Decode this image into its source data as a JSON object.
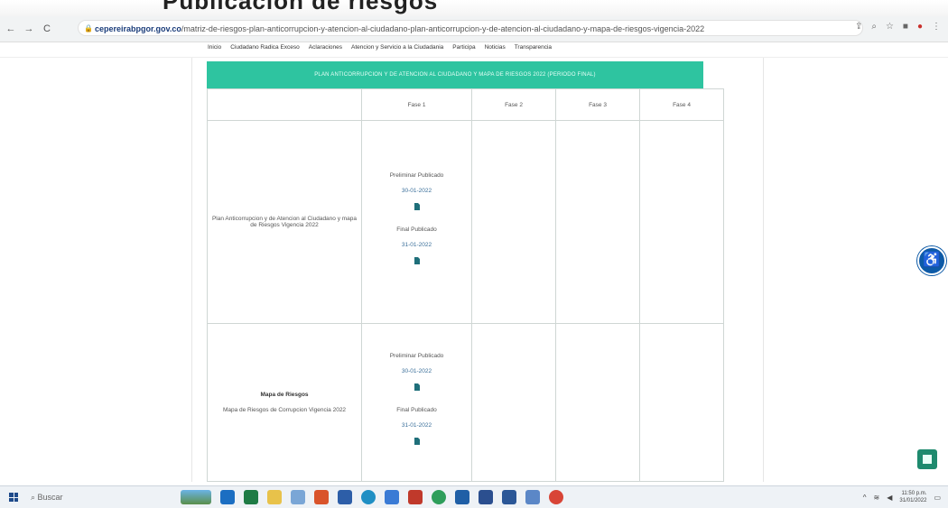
{
  "browser": {
    "url_host": "cepereirabpgor.gov.co",
    "url_path": "/matriz-de-riesgos-plan-anticorrupcion-y-atencion-al-ciudadano-plan-anticorrupcion-y-de-atencion-al-ciudadano-y-mapa-de-riesgos-vigencia-2022",
    "nav_back": "←",
    "nav_forward": "→",
    "reload": "C"
  },
  "site_nav": {
    "items": [
      "Inicio",
      "Ciudadano Radica Exceso",
      "Aclaraciones",
      "Atencion y Servicio a la Ciudadania",
      "Participa",
      "Noticias",
      "Transparencia"
    ]
  },
  "table": {
    "title": "PLAN ANTICORRUPCION Y DE ATENCION AL CIUDADANO Y MAPA DE RIESGOS 2022 (PERIODO FINAL)",
    "columns": [
      "",
      "Fase 1",
      "Fase 2",
      "Fase 3",
      "Fase 4"
    ],
    "rows": [
      {
        "description": "Plan Anticorrupcion y de Atencion al Ciudadano y mapa de Riesgos Vigencia 2022",
        "fase1": [
          {
            "label": "Preliminar Publicado",
            "date": "30-01-2022"
          },
          {
            "label": "Final Publicado",
            "date": "31-01-2022"
          }
        ]
      },
      {
        "title": "Mapa de Riesgos",
        "description": "Mapa de Riesgos de Corrupcion Vigencia 2022",
        "fase1": [
          {
            "label": "Preliminar Publicado",
            "date": "30-01-2022"
          },
          {
            "label": "Final Publicado",
            "date": "31-01-2022"
          }
        ]
      }
    ]
  },
  "taskbar": {
    "search_label": "Buscar",
    "clock_time": "11:50 p.m.",
    "clock_date": "31/01/2022"
  },
  "colors": {
    "accent": "#2ec4a0",
    "link": "#3a6f9a"
  }
}
